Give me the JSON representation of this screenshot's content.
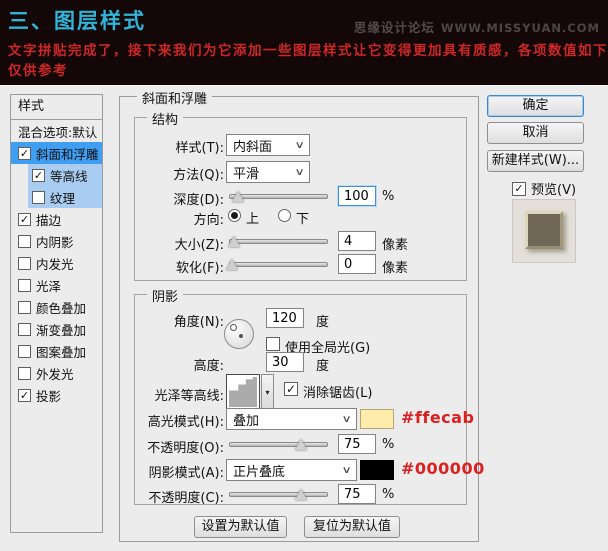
{
  "header": {
    "title": "三、图层样式",
    "line1": "文字拼贴完成了，接下来我们为它添加一些图层样式让它变得更加具有质感，各项数值如下，",
    "line2": "仅供参考",
    "watermark_cn": "思缘设计论坛",
    "watermark_url": "WWW.MISSYUAN.COM"
  },
  "icons": {
    "chevron_down": "∨",
    "menu_arrow": "▾"
  },
  "sidebar": {
    "header": "样式",
    "items": [
      {
        "label": "混合选项:默认",
        "check": ""
      },
      {
        "label": "斜面和浮雕",
        "check": "✓"
      },
      {
        "label": "等高线",
        "check": "✓"
      },
      {
        "label": "纹理",
        "check": ""
      },
      {
        "label": "描边",
        "check": "✓"
      },
      {
        "label": "内阴影",
        "check": ""
      },
      {
        "label": "内发光",
        "check": ""
      },
      {
        "label": "光泽",
        "check": ""
      },
      {
        "label": "颜色叠加",
        "check": ""
      },
      {
        "label": "渐变叠加",
        "check": ""
      },
      {
        "label": "图案叠加",
        "check": ""
      },
      {
        "label": "外发光",
        "check": ""
      },
      {
        "label": "投影",
        "check": "✓"
      }
    ]
  },
  "panel": {
    "legend": "斜面和浮雕",
    "structure": {
      "legend": "结构",
      "style_label": "样式(T):",
      "style_value": "内斜面",
      "method_label": "方法(Q):",
      "method_value": "平滑",
      "depth_label": "深度(D):",
      "depth_value": "100",
      "depth_unit": "%",
      "direction_label": "方向:",
      "direction_up": "上",
      "direction_down": "下",
      "direction_selected": "up",
      "size_label": "大小(Z):",
      "size_value": "4",
      "size_unit": "像素",
      "soften_label": "软化(F):",
      "soften_value": "0",
      "soften_unit": "像素"
    },
    "shading": {
      "legend": "阴影",
      "angle_label": "角度(N):",
      "angle_value": "120",
      "angle_unit": "度",
      "global_light": "使用全局光(G)",
      "global_light_check": "",
      "altitude_label": "高度:",
      "altitude_value": "30",
      "altitude_unit": "度",
      "gloss_label": "光泽等高线:",
      "antialias": "消除锯齿(L)",
      "antialias_check": "✓",
      "highlight_label": "高光模式(H):",
      "highlight_value": "叠加",
      "opacity_h_label": "不透明度(O):",
      "opacity_h_value": "75",
      "opacity_h_unit": "%",
      "shadow_label": "阴影模式(A):",
      "shadow_value": "正片叠底",
      "opacity_s_label": "不透明度(C):",
      "opacity_s_value": "75",
      "opacity_s_unit": "%"
    },
    "set_default": "设置为默认值",
    "reset_default": "复位为默认值"
  },
  "actions": {
    "ok": "确定",
    "cancel": "取消",
    "new_style": "新建样式(W)...",
    "preview": "预览(V)",
    "preview_check": "✓"
  },
  "colors": {
    "highlight_swatch": "#ffecab",
    "shadow_swatch": "#000000",
    "accent_title": "#31b4d8",
    "accent_red": "#cd2727",
    "selection_blue": "#3f9df2"
  },
  "annotations": {
    "highlight_hex": "#ffecab",
    "shadow_hex": "#000000"
  }
}
